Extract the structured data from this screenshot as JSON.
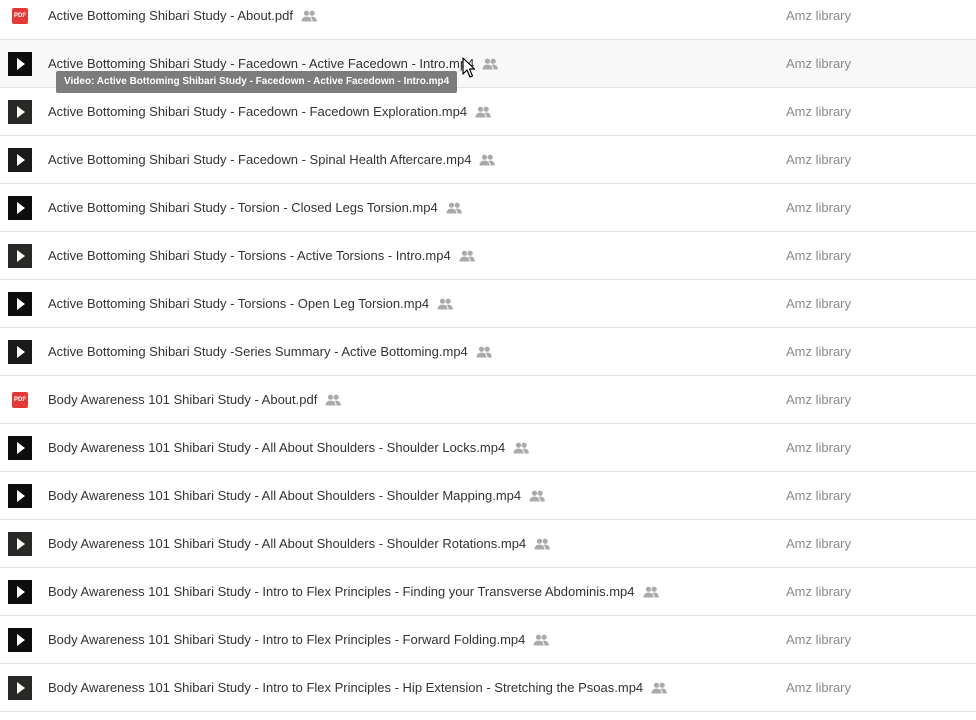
{
  "files": [
    {
      "name": "Active Bottoming Shibari Study - About.pdf",
      "type": "pdf",
      "owner": "Amz library"
    },
    {
      "name": "Active Bottoming Shibari Study - Facedown - Active Facedown - Intro.mp4",
      "type": "video",
      "owner": "Amz library"
    },
    {
      "name": "Active Bottoming Shibari Study - Facedown - Facedown Exploration.mp4",
      "type": "video",
      "owner": "Amz library"
    },
    {
      "name": "Active Bottoming Shibari Study - Facedown - Spinal Health Aftercare.mp4",
      "type": "video",
      "owner": "Amz library"
    },
    {
      "name": "Active Bottoming Shibari Study - Torsion - Closed Legs Torsion.mp4",
      "type": "video",
      "owner": "Amz library"
    },
    {
      "name": "Active Bottoming Shibari Study - Torsions - Active Torsions - Intro.mp4",
      "type": "video",
      "owner": "Amz library"
    },
    {
      "name": "Active Bottoming Shibari Study - Torsions - Open Leg Torsion.mp4",
      "type": "video",
      "owner": "Amz library"
    },
    {
      "name": "Active Bottoming Shibari Study -Series Summary - Active Bottoming.mp4",
      "type": "video",
      "owner": "Amz library"
    },
    {
      "name": "Body Awareness 101 Shibari Study - About.pdf",
      "type": "pdf",
      "owner": "Amz library"
    },
    {
      "name": "Body Awareness 101 Shibari Study - All About Shoulders - Shoulder Locks.mp4",
      "type": "video",
      "owner": "Amz library"
    },
    {
      "name": "Body Awareness 101 Shibari Study - All About Shoulders - Shoulder Mapping.mp4",
      "type": "video",
      "owner": "Amz library"
    },
    {
      "name": "Body Awareness 101 Shibari Study - All About Shoulders - Shoulder Rotations.mp4",
      "type": "video",
      "owner": "Amz library"
    },
    {
      "name": "Body Awareness 101 Shibari Study - Intro to Flex Principles - Finding your Transverse Abdominis.mp4",
      "type": "video",
      "owner": "Amz library"
    },
    {
      "name": "Body Awareness 101 Shibari Study - Intro to Flex Principles - Forward Folding.mp4",
      "type": "video",
      "owner": "Amz library"
    },
    {
      "name": "Body Awareness 101 Shibari Study - Intro to Flex Principles - Hip Extension - Stretching the Psoas.mp4",
      "type": "video",
      "owner": "Amz library"
    }
  ],
  "pdf_badge": "PDF",
  "shared_icon": "people-icon",
  "tooltip": "Video: Active Bottoming Shibari Study - Facedown - Active Facedown - Intro.mp4",
  "colors": {
    "pdf_red": "#e53935",
    "owner_text": "#8a8a8a",
    "tooltip_bg": "#7c7c7c"
  }
}
